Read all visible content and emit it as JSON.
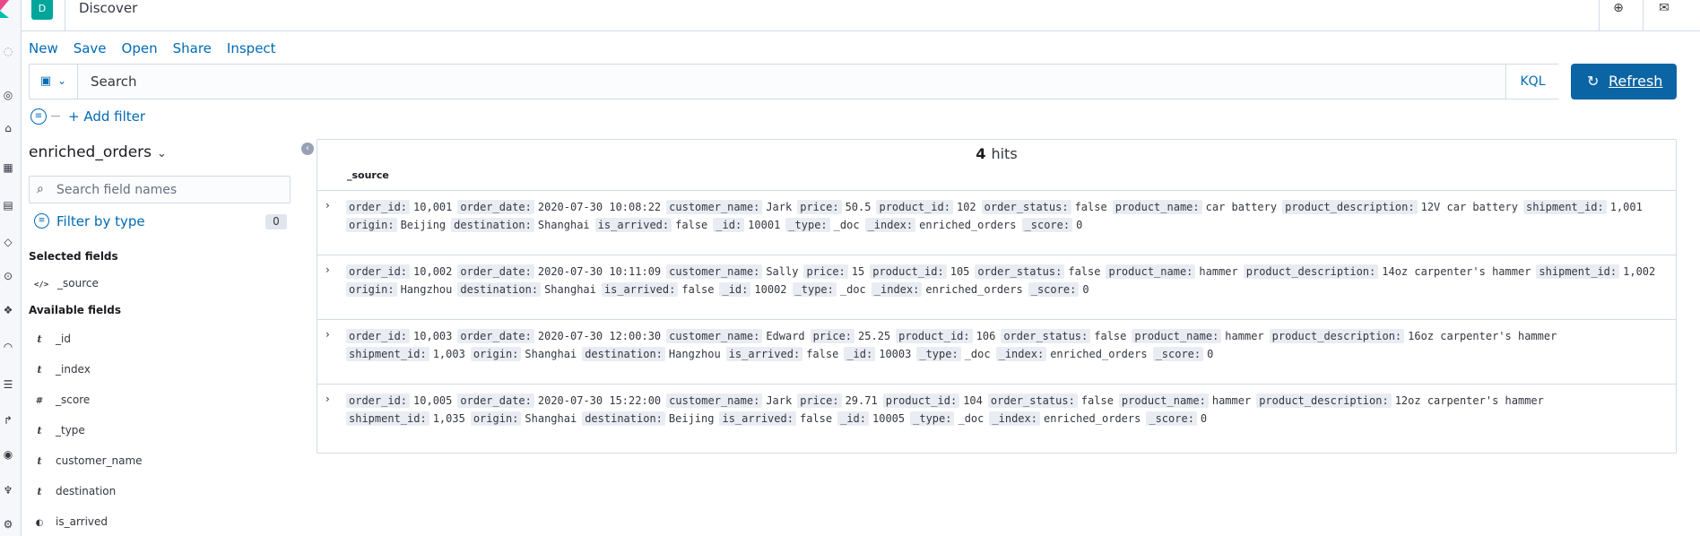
{
  "header": {
    "space_letter": "D",
    "title": "Discover"
  },
  "menu": [
    "New",
    "Save",
    "Open",
    "Share",
    "Inspect"
  ],
  "query": {
    "placeholder": "Search",
    "language": "KQL",
    "refresh_label": "Refresh"
  },
  "filters": {
    "add_label": "+ Add filter"
  },
  "sidebar": {
    "index": "enriched_orders",
    "field_search_placeholder": "Search field names",
    "filter_by_type": "Filter by type",
    "filter_count": "0",
    "selected_heading": "Selected fields",
    "selected": [
      {
        "type": "</>",
        "name": "_source"
      }
    ],
    "available_heading": "Available fields",
    "available": [
      {
        "type": "t",
        "name": "_id"
      },
      {
        "type": "t",
        "name": "_index"
      },
      {
        "type": "#",
        "name": "_score"
      },
      {
        "type": "t",
        "name": "_type"
      },
      {
        "type": "t",
        "name": "customer_name"
      },
      {
        "type": "t",
        "name": "destination"
      },
      {
        "type": "◐",
        "name": "is_arrived"
      }
    ]
  },
  "results": {
    "hits_count": "4",
    "hits_label": "hits",
    "column": "_source",
    "rows": [
      {
        "line1": [
          [
            "order_id:",
            "10,001"
          ],
          [
            "order_date:",
            "2020-07-30 10:08:22"
          ],
          [
            "customer_name:",
            "Jark"
          ],
          [
            "price:",
            "50.5"
          ],
          [
            "product_id:",
            "102"
          ],
          [
            "order_status:",
            "false"
          ],
          [
            "product_name:",
            "car battery"
          ],
          [
            "product_description:",
            "12V car battery"
          ],
          [
            "shipment_id:",
            "1,001"
          ]
        ],
        "line2": [
          [
            "origin:",
            "Beijing"
          ],
          [
            "destination:",
            "Shanghai"
          ],
          [
            "is_arrived:",
            "false"
          ],
          [
            "_id:",
            "10001"
          ],
          [
            "_type:",
            "_doc"
          ],
          [
            "_index:",
            "enriched_orders"
          ],
          [
            "_score:",
            "0"
          ]
        ]
      },
      {
        "line1": [
          [
            "order_id:",
            "10,002"
          ],
          [
            "order_date:",
            "2020-07-30 10:11:09"
          ],
          [
            "customer_name:",
            "Sally"
          ],
          [
            "price:",
            "15"
          ],
          [
            "product_id:",
            "105"
          ],
          [
            "order_status:",
            "false"
          ],
          [
            "product_name:",
            "hammer"
          ],
          [
            "product_description:",
            "14oz carpenter's hammer"
          ],
          [
            "shipment_id:",
            "1,002"
          ]
        ],
        "line2": [
          [
            "origin:",
            "Hangzhou"
          ],
          [
            "destination:",
            "Shanghai"
          ],
          [
            "is_arrived:",
            "false"
          ],
          [
            "_id:",
            "10002"
          ],
          [
            "_type:",
            "_doc"
          ],
          [
            "_index:",
            "enriched_orders"
          ],
          [
            "_score:",
            "0"
          ]
        ]
      },
      {
        "line1": [
          [
            "order_id:",
            "10,003"
          ],
          [
            "order_date:",
            "2020-07-30 12:00:30"
          ],
          [
            "customer_name:",
            "Edward"
          ],
          [
            "price:",
            "25.25"
          ],
          [
            "product_id:",
            "106"
          ],
          [
            "order_status:",
            "false"
          ],
          [
            "product_name:",
            "hammer"
          ],
          [
            "product_description:",
            "16oz carpenter's hammer"
          ]
        ],
        "line2": [
          [
            "shipment_id:",
            "1,003"
          ],
          [
            "origin:",
            "Shanghai"
          ],
          [
            "destination:",
            "Hangzhou"
          ],
          [
            "is_arrived:",
            "false"
          ],
          [
            "_id:",
            "10003"
          ],
          [
            "_type:",
            "_doc"
          ],
          [
            "_index:",
            "enriched_orders"
          ],
          [
            "_score:",
            "0"
          ]
        ]
      },
      {
        "line1": [
          [
            "order_id:",
            "10,005"
          ],
          [
            "order_date:",
            "2020-07-30 15:22:00"
          ],
          [
            "customer_name:",
            "Jark"
          ],
          [
            "price:",
            "29.71"
          ],
          [
            "product_id:",
            "104"
          ],
          [
            "order_status:",
            "false"
          ],
          [
            "product_name:",
            "hammer"
          ],
          [
            "product_description:",
            "12oz carpenter's hammer"
          ]
        ],
        "line2": [
          [
            "shipment_id:",
            "1,035"
          ],
          [
            "origin:",
            "Shanghai"
          ],
          [
            "destination:",
            "Beijing"
          ],
          [
            "is_arrived:",
            "false"
          ],
          [
            "_id:",
            "10005"
          ],
          [
            "_type:",
            "_doc"
          ],
          [
            "_index:",
            "enriched_orders"
          ],
          [
            "_score:",
            "0"
          ]
        ]
      }
    ]
  }
}
